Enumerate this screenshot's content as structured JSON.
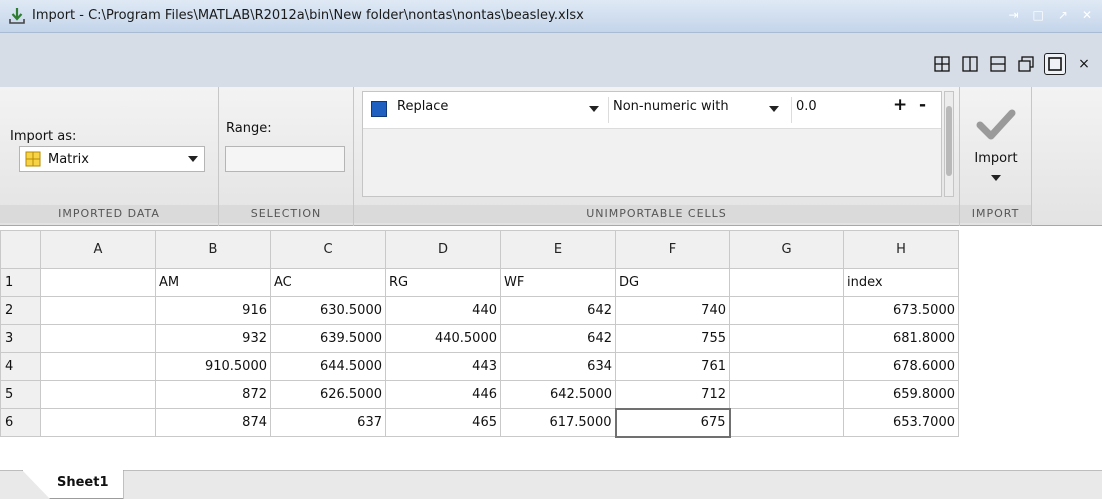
{
  "window": {
    "title": "Import - C:\\Program Files\\MATLAB\\R2012a\\bin\\New folder\\nontas\\nontas\\beasley.xlsx",
    "buttons": [
      "dock",
      "maximize",
      "undock",
      "close"
    ]
  },
  "layout_buttons": [
    "tile-grid",
    "tile-columns",
    "tile-rows",
    "float",
    "maximize",
    "close"
  ],
  "toolstrip": {
    "imported_data": {
      "import_as_label": "Import as:",
      "import_as_value": "Matrix",
      "section_label": "IMPORTED DATA"
    },
    "selection": {
      "range_label": "Range:",
      "range_value": "",
      "section_label": "SELECTION"
    },
    "unimportable": {
      "rule_action": "Replace",
      "rule_condition": "Non-numeric with",
      "rule_value": "0.0",
      "add_label": "+",
      "remove_label": "-",
      "section_label": "UNIMPORTABLE CELLS",
      "rule_color": "#1f5fbf"
    },
    "import": {
      "button_label": "Import",
      "section_label": "IMPORT"
    }
  },
  "grid": {
    "columns": [
      "A",
      "B",
      "C",
      "D",
      "E",
      "F",
      "G",
      "H"
    ],
    "rows": [
      {
        "n": "1",
        "cells": [
          "",
          "AM",
          "AC",
          "RG",
          "WF",
          "DG",
          "",
          "index"
        ]
      },
      {
        "n": "2",
        "cells": [
          "",
          "916",
          "630.5000",
          "440",
          "642",
          "740",
          "",
          "673.5000"
        ]
      },
      {
        "n": "3",
        "cells": [
          "",
          "932",
          "639.5000",
          "440.5000",
          "642",
          "755",
          "",
          "681.8000"
        ]
      },
      {
        "n": "4",
        "cells": [
          "",
          "910.5000",
          "644.5000",
          "443",
          "634",
          "761",
          "",
          "678.6000"
        ]
      },
      {
        "n": "5",
        "cells": [
          "",
          "872",
          "626.5000",
          "446",
          "642.5000",
          "712",
          "",
          "659.8000"
        ]
      },
      {
        "n": "6",
        "cells": [
          "",
          "874",
          "637",
          "465",
          "617.5000",
          "675",
          "",
          "653.7000"
        ]
      }
    ]
  },
  "sheet_tab": "Sheet1"
}
